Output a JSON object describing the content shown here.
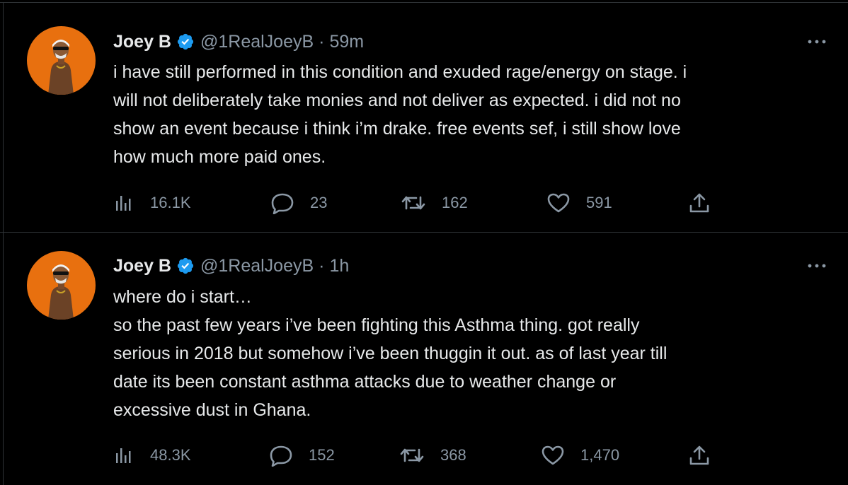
{
  "tweets": [
    {
      "display_name": "Joey B",
      "handle": "@1RealJoeyB",
      "separator": "·",
      "time": "59m",
      "text": "i have still performed in this condition and exuded rage/energy on stage. i\nwill not deliberately take monies and not deliver as expected. i did not no\nshow an event because i think i’m drake.  free events sef, i still show love\nhow much more paid ones.",
      "views": "16.1K",
      "replies": "23",
      "retweets": "162",
      "likes": "591"
    },
    {
      "display_name": "Joey B",
      "handle": "@1RealJoeyB",
      "separator": "·",
      "time": "1h",
      "text": "where do i start…\nso the past few years i’ve been fighting this Asthma thing. got really\nserious in 2018 but somehow i’ve been thuggin it out. as of last year till\ndate its been constant asthma attacks due to weather change or\nexcessive dust in Ghana.",
      "views": "48.3K",
      "replies": "152",
      "retweets": "368",
      "likes": "1,470"
    }
  ],
  "colors": {
    "background": "#000000",
    "text": "#e7e9ea",
    "muted": "#8b98a5",
    "verified": "#1d9bf0",
    "avatar_bg": "#e8700f",
    "border": "#2f3336"
  },
  "icons": [
    "verified-badge-icon",
    "more-icon",
    "views-icon",
    "reply-icon",
    "retweet-icon",
    "like-icon",
    "share-icon"
  ]
}
